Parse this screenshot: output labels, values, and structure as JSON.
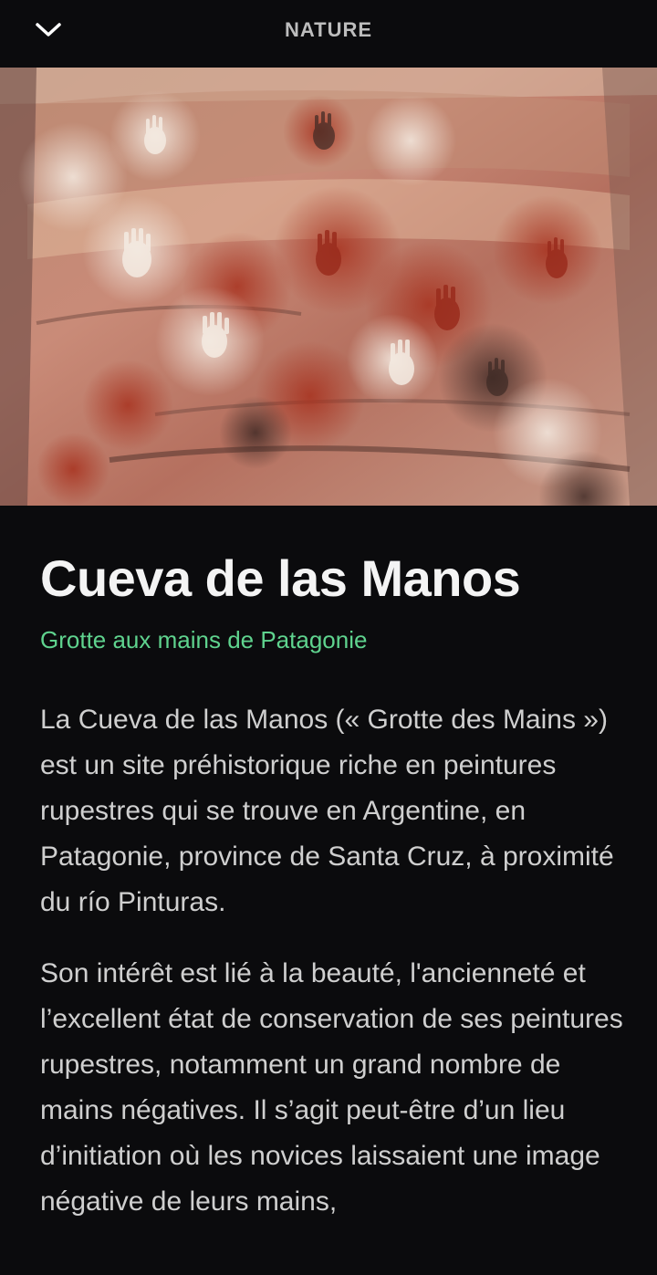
{
  "header": {
    "back_icon": "chevron-down-icon",
    "section": "NATURE"
  },
  "hero": {
    "image_description_icon": "cave-hands-photo"
  },
  "article": {
    "title": "Cueva de las Manos",
    "subtitle": "Grotte aux mains de Patagonie",
    "paragraphs": [
      "La Cueva de las Manos (« Grotte des Mains ») est un site préhistorique riche en peintures rupestres qui se trouve en Argentine, en Patagonie, province de Santa Cruz, à proximité du río Pinturas.",
      "Son intérêt est lié à la beauté, l'ancienneté et l’excellent état de conservation de ses peintures rupestres, notamment un grand nombre de mains négatives. Il s’agit peut-être d’un lieu d’initiation où les novices laissaient une image négative de leurs mains,"
    ]
  },
  "colors": {
    "background": "#0b0b0d",
    "title": "#f4f4f4",
    "accent": "#5fd38e",
    "body_text": "#cfcfcf",
    "header_text": "#bdbdbd"
  }
}
